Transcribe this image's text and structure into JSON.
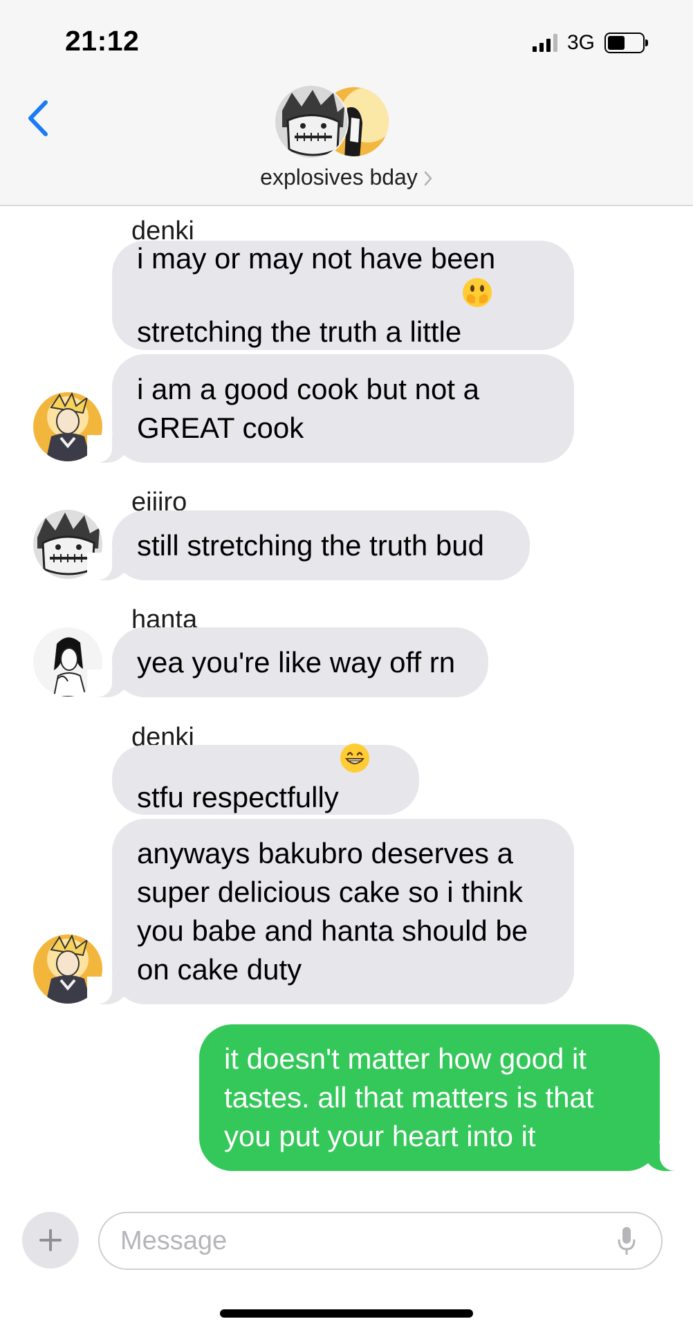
{
  "status_bar": {
    "time": "21:12",
    "network": "3G"
  },
  "header": {
    "title": "explosives bday"
  },
  "messages": [
    {
      "sender": "denki",
      "text": "i may or may not have been\nstretching the truth a little",
      "emoji": "hand-over-mouth-emoji"
    },
    {
      "text": "i am a good cook but not a\nGREAT cook"
    },
    {
      "sender": "eijiro",
      "text": "still stretching the truth bud"
    },
    {
      "sender": "hanta",
      "text": "yea you're like way off rn"
    },
    {
      "sender": "denki",
      "text": "stfu respectfully",
      "emoji": "grinning-face-emoji"
    },
    {
      "text": "anyways bakubro deserves a\nsuper delicious cake so i think\nyou babe and hanta should be\non cake duty"
    },
    {
      "text": "it doesn't matter how good it\ntastes. all that matters is that\nyou put your heart into it"
    }
  ],
  "input": {
    "placeholder": "Message"
  },
  "colors": {
    "sent_bubble": "#34c759",
    "received_bubble": "#e6e6eb",
    "accent": "#1a7cf5"
  }
}
